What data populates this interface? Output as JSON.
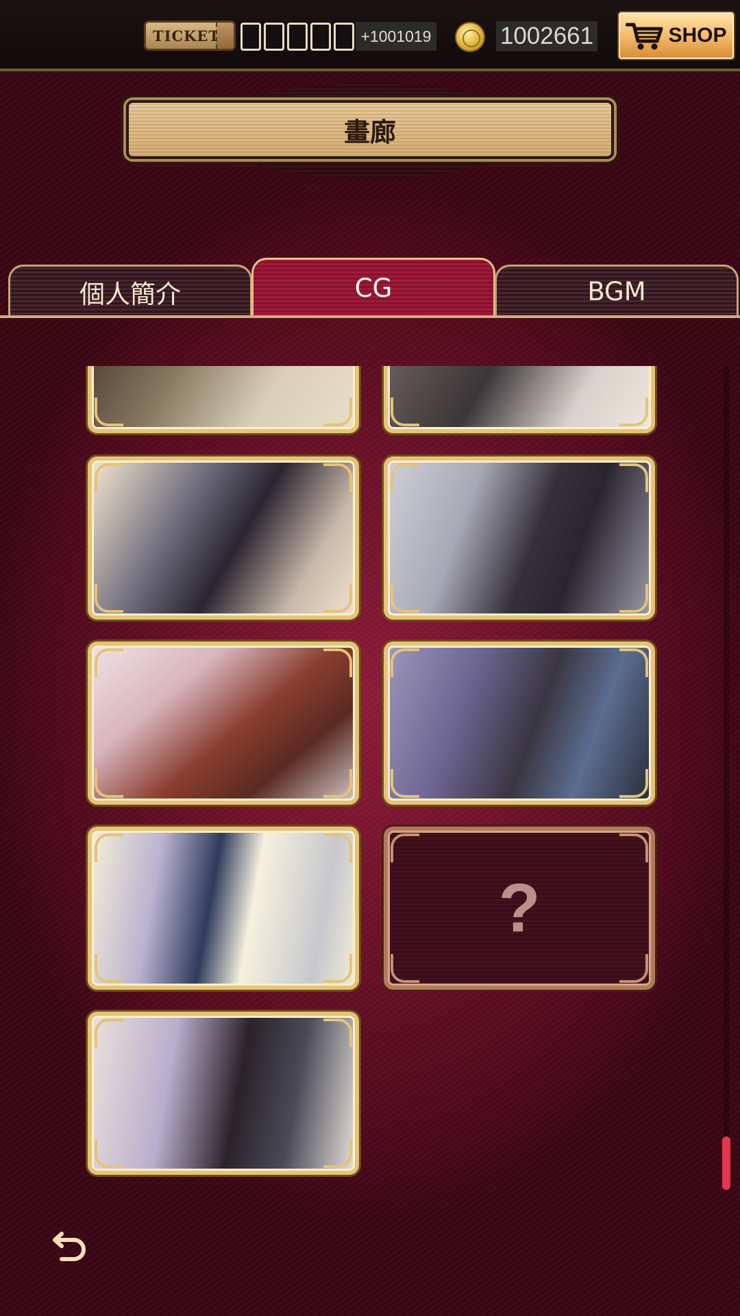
{
  "header": {
    "ticket_label": "TICKET",
    "ticket_slots": 5,
    "ticket_extra": "+1001019",
    "coins": "1002661",
    "shop_label": "SHOP",
    "icons": [
      "ticket-icon",
      "coin-icon",
      "cart-icon"
    ],
    "accent": "#e5c37a"
  },
  "page": {
    "title": "畫廊"
  },
  "tabs": [
    {
      "label": "個人簡介",
      "active": false
    },
    {
      "label": "CG",
      "active": true
    },
    {
      "label": "BGM",
      "active": false
    }
  ],
  "gallery": {
    "items": [
      {
        "state": "unlocked"
      },
      {
        "state": "unlocked"
      },
      {
        "state": "unlocked"
      },
      {
        "state": "unlocked"
      },
      {
        "state": "unlocked"
      },
      {
        "state": "unlocked"
      },
      {
        "state": "unlocked"
      },
      {
        "state": "locked",
        "label": "?"
      },
      {
        "state": "unlocked"
      }
    ]
  },
  "scrollbar": {
    "position": 0.95
  },
  "footer": {
    "back_icon": "back-arrow-icon"
  }
}
